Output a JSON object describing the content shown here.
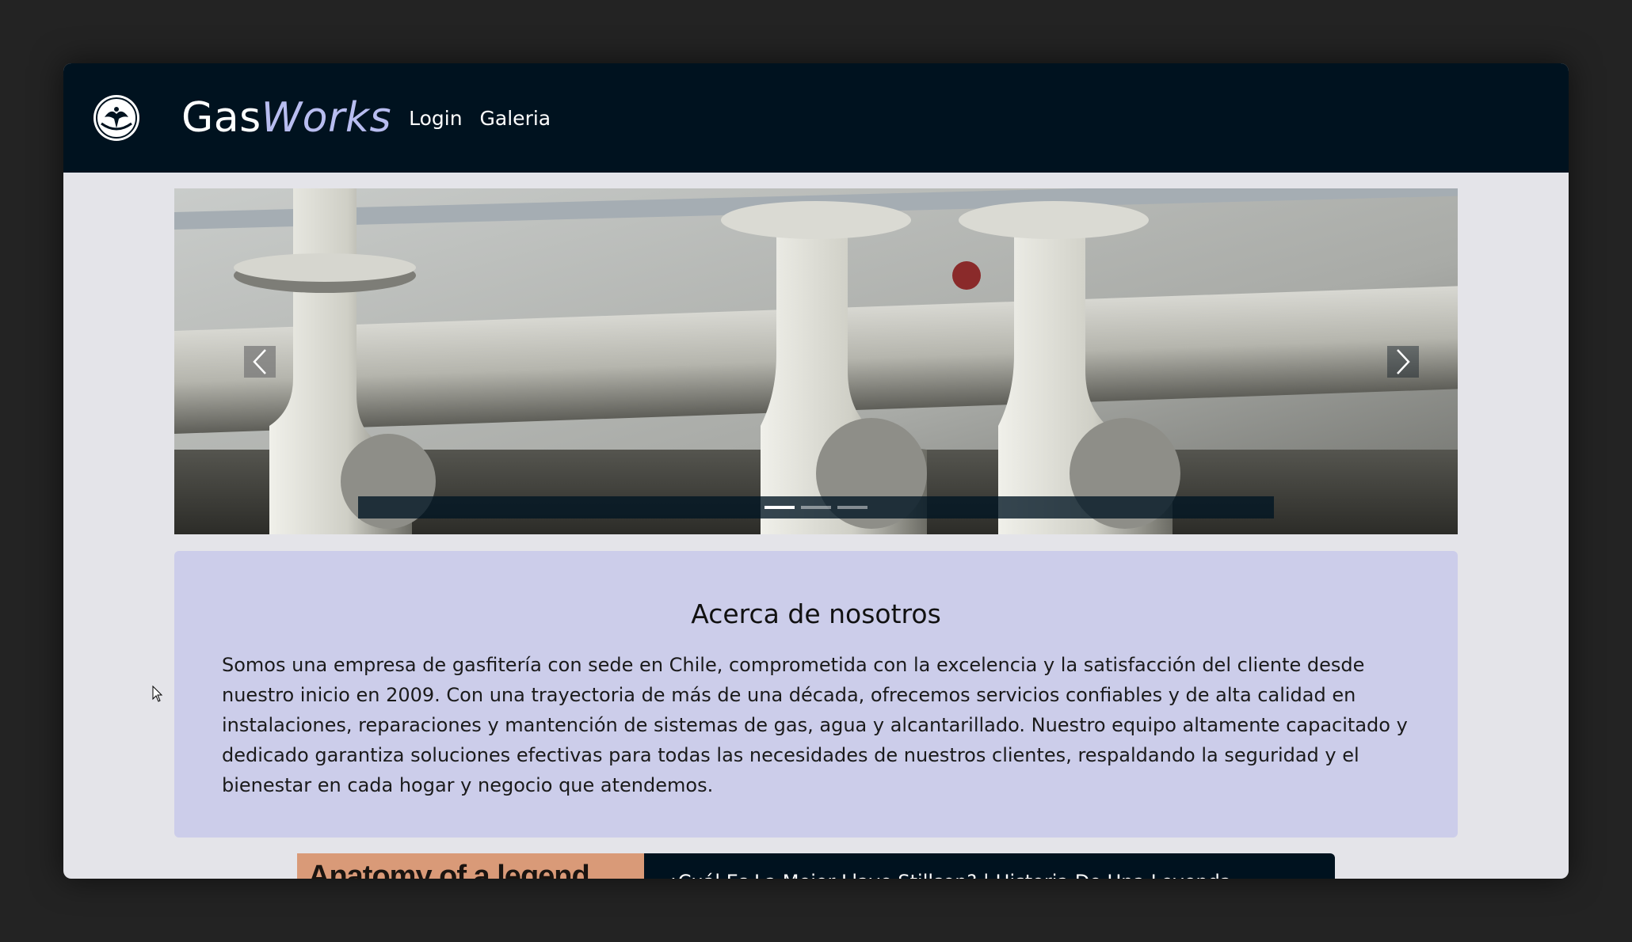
{
  "header": {
    "logo_icon": "eagle-emblem-icon",
    "brand_part1": "Gas",
    "brand_part2": "Works",
    "nav": [
      {
        "label": "Login"
      },
      {
        "label": "Galeria"
      }
    ]
  },
  "carousel": {
    "prev_icon": "chevron-left-icon",
    "next_icon": "chevron-right-icon",
    "indicators": 3,
    "active_index": 0
  },
  "about": {
    "title": "Acerca de nosotros",
    "body": "Somos una empresa de gasfitería con sede en Chile, comprometida con la excelencia y la satisfacción del cliente desde nuestro inicio en 2009. Con una trayectoria de más de una década, ofrecemos servicios confiables y de alta calidad en instalaciones, reparaciones y mantención de sistemas de gas, agua y alcantarillado. Nuestro equipo altamente capacitado y dedicado garantiza soluciones efectivas para todas las necesidades de nuestros clientes, respaldando la seguridad y el bienestar en cada hogar y negocio que atendemos."
  },
  "video": {
    "thumb_text": "Anatomy of a legend",
    "title": "¿Cuál Es La Mejor Llave Stillson? | Historia De Una Leyenda"
  },
  "colors": {
    "navbar": "#00121f",
    "brand_accent": "#b8bdf0",
    "about_bg": "#cccdea",
    "page_bg": "#e4e4e9"
  }
}
